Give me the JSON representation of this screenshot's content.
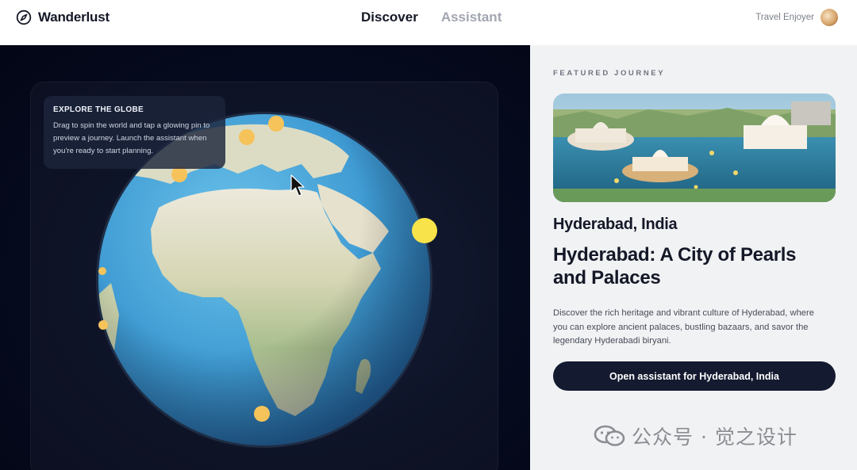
{
  "app": {
    "title": "Wanderlust",
    "logo_icon": "compass-icon"
  },
  "nav": {
    "tabs": [
      {
        "label": "Discover",
        "active": true
      },
      {
        "label": "Assistant",
        "active": false
      }
    ]
  },
  "user": {
    "name": "Travel Enjoyer",
    "avatar_icon": "avatar-icon"
  },
  "globe": {
    "tip_title": "EXPLORE THE GLOBE",
    "tip_body": "Drag to spin the world and tap a glowing pin to preview a journey. Launch the assistant when you're ready to start planning.",
    "pin_color": "#f6c35b",
    "active_pin_color": "#f9e34a",
    "ocean_color": "#4aa3d8",
    "land_color": "#c9cfae"
  },
  "featured": {
    "eyebrow": "FEATURED JOURNEY",
    "destination": "Hyderabad, India",
    "headline": "Hyderabad: A City of Pearls and Palaces",
    "description": "Discover the rich heritage and vibrant culture of Hyderabad, where you can explore ancient palaces, bustling bazaars, and savor the legendary Hyderabadi biryani.",
    "cta_label": "Open assistant for Hyderabad, India"
  },
  "watermark": {
    "text": "公众号 · 觉之设计",
    "icon": "wechat-icon"
  },
  "colors": {
    "accent_dark": "#141a2f",
    "panel_bg": "#f1f2f4",
    "stage_bg": "#060b1f"
  }
}
